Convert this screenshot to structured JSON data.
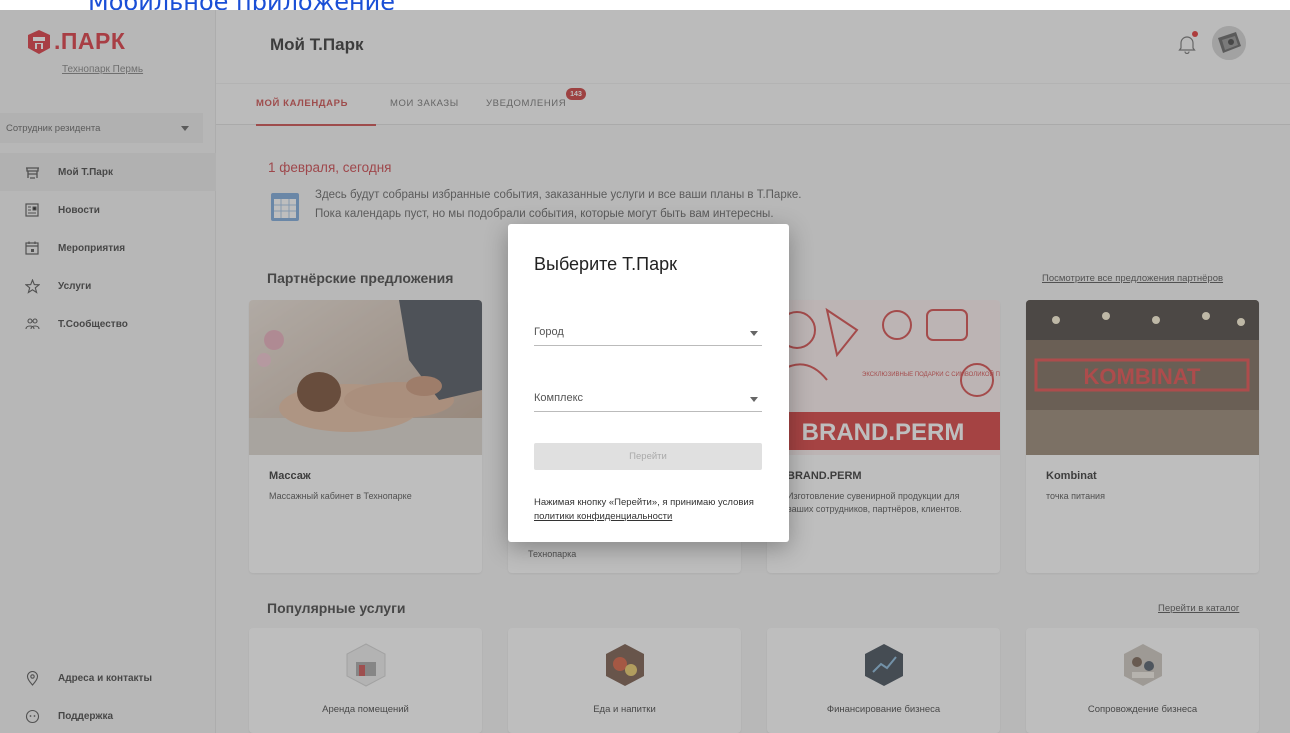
{
  "top_link": "Мобильное приложение",
  "sidebar": {
    "logo_text": ".ПАРК",
    "logo_subtitle": "Технопарк Пермь",
    "role_select": "Сотрудник резидента",
    "items": [
      {
        "label": "Мой Т.Парк",
        "icon": "park-icon"
      },
      {
        "label": "Новости",
        "icon": "news-icon"
      },
      {
        "label": "Мероприятия",
        "icon": "calendar-icon"
      },
      {
        "label": "Услуги",
        "icon": "star-icon"
      },
      {
        "label": "Т.Сообщество",
        "icon": "community-icon"
      }
    ],
    "bottom_items": [
      {
        "label": "Адреса и контакты",
        "icon": "location-icon"
      },
      {
        "label": "Поддержка",
        "icon": "support-icon"
      }
    ]
  },
  "header": {
    "title": "Мой Т.Парк",
    "notifications_icon": "bell-icon"
  },
  "tabs": [
    {
      "label": "МОЙ КАЛЕНДАРЬ",
      "active": true
    },
    {
      "label": "МОИ ЗАКАЗЫ",
      "active": false
    },
    {
      "label": "УВЕДОМЛЕНИЯ",
      "active": false,
      "badge": "143"
    }
  ],
  "calendar": {
    "date_title": "1 февраля, сегодня",
    "info_line1": "Здесь будут собраны избранные события, заказанные услуги и все ваши планы в Т.Парке.",
    "info_line2": "Пока календарь пуст, но мы подобрали события, которые могут быть вам интересны."
  },
  "partners": {
    "title": "Партнёрские предложения",
    "link": "Посмотрите все предложения партнёров",
    "cards": [
      {
        "title": "Массаж",
        "desc": "Массажный кабинет в Технопарке"
      },
      {
        "title": "",
        "desc": "Технопарка"
      },
      {
        "title": "BRAND.PERM",
        "desc": "Изготовление сувенирной продукции для ваших сотрудников, партнёров, клиентов.",
        "banner_text": "BRAND.PERM",
        "banner_small": "ЭКСКЛЮЗИВНЫЕ ПОДАРКИ С СИМВОЛИКОЙ ПЕРМСКОГО КРАЯ"
      },
      {
        "title": "Kombinat",
        "desc": "точка питания",
        "sign_text": "KOMBINAT"
      }
    ]
  },
  "services": {
    "title": "Популярные услуги",
    "link": "Перейти в каталог",
    "items": [
      {
        "label": "Аренда помещений"
      },
      {
        "label": "Еда и напитки"
      },
      {
        "label": "Финансирование бизнеса"
      },
      {
        "label": "Сопровождение бизнеса"
      }
    ]
  },
  "modal": {
    "title": "Выберите Т.Парк",
    "city_label": "Город",
    "complex_label": "Комплекс",
    "go_button": "Перейти",
    "terms_text": "Нажимая кнопку «Перейти», я принимаю условия ",
    "terms_link": "политики конфиденциальности"
  },
  "colors": {
    "brand_red": "#d9232e",
    "accent_red": "#c8323a",
    "badge_red": "#c62828"
  }
}
